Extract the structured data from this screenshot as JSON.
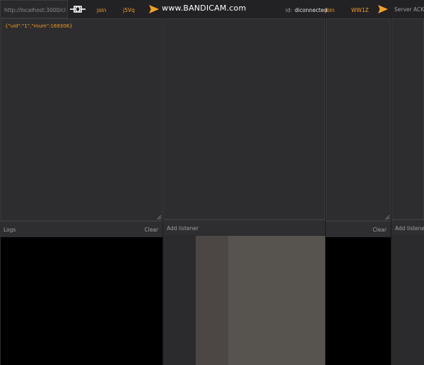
{
  "toolbar": {
    "url": "http://localhost:3000/cl",
    "join_label": "join",
    "room_left": "j5Vq",
    "id_label": "id:",
    "id_value": "diconnected",
    "room_right": "WW1Z",
    "ack_label": "Server ACK Ra",
    "accent_color": "#f4a020"
  },
  "watermark": {
    "text": "www.BANDICAM.com"
  },
  "editor_left": {
    "content": "{\"uid\":\"1\",\"rnum\":169306}"
  },
  "logs": {
    "label": "Logs",
    "clear_label": "Clear"
  },
  "listener": {
    "label": "Add listener"
  },
  "icons": {
    "connect": "plug-icon",
    "send": "send-arrow-icon",
    "resize": "resize-grip-icon"
  }
}
